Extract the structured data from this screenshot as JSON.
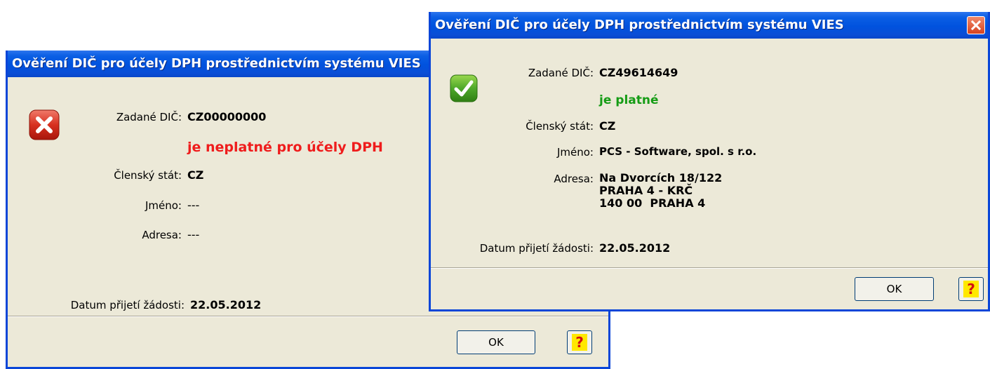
{
  "invalid_dialog": {
    "title": "Ověření DIČ pro účely DPH prostřednictvím systému VIES",
    "icon": "error-x-icon",
    "vat_label": "Zadané DIČ:",
    "vat_value": "CZ00000000",
    "status": "je neplatné pro účely DPH",
    "status_color": "#ef1c1c",
    "country_label": "Členský stát:",
    "country_value": "CZ",
    "name_label": "Jméno:",
    "name_value": "---",
    "address_label": "Adresa:",
    "address_value": "---",
    "date_label": "Datum přijetí žádosti:",
    "date_value": "22.05.2012",
    "ok_label": "OK",
    "help_label": "?"
  },
  "valid_dialog": {
    "title": "Ověření DIČ pro účely DPH prostřednictvím systému VIES",
    "icon": "success-check-icon",
    "vat_label": "Zadané DIČ:",
    "vat_value": "CZ49614649",
    "status": "je platné",
    "status_color": "#159c15",
    "country_label": "Členský stát:",
    "country_value": "CZ",
    "name_label": "Jméno:",
    "name_value": "PCS - Software, spol. s r.o.",
    "address_label": "Adresa:",
    "address_lines": [
      "Na Dvorcích 18/122",
      "PRAHA 4 - KRČ",
      "140 00  PRAHA 4"
    ],
    "date_label": "Datum přijetí žádosti:",
    "date_value": "22.05.2012",
    "ok_label": "OK",
    "help_label": "?"
  },
  "colors": {
    "titlebar": "#0052de",
    "dialog_bg": "#ece9d8",
    "border": "#0a46d8"
  }
}
